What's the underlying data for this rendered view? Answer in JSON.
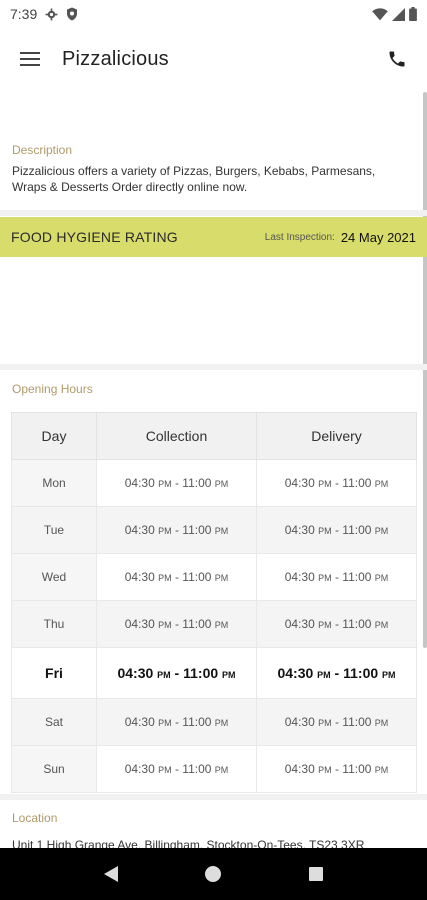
{
  "status_bar": {
    "time": "7:39"
  },
  "app_bar": {
    "title": "Pizzalicious"
  },
  "description": {
    "label": "Description",
    "text": "Pizzalicious offers a variety of Pizzas, Burgers, Kebabs, Parmesans, Wraps & Desserts Order directly online now."
  },
  "hygiene": {
    "label": "FOOD HYGIENE RATING",
    "inspection_label": "Last Inspection:",
    "inspection_date": "24 May 2021",
    "accent_color": "#d8dc6a"
  },
  "opening_hours": {
    "label": "Opening Hours",
    "headers": [
      "Day",
      "Collection",
      "Delivery"
    ],
    "rows": [
      {
        "day": "Mon",
        "col_open": "04:30",
        "col_close": "11:00",
        "del_open": "04:30",
        "del_close": "11:00"
      },
      {
        "day": "Tue",
        "col_open": "04:30",
        "col_close": "11:00",
        "del_open": "04:30",
        "del_close": "11:00"
      },
      {
        "day": "Wed",
        "col_open": "04:30",
        "col_close": "11:00",
        "del_open": "04:30",
        "del_close": "11:00"
      },
      {
        "day": "Thu",
        "col_open": "04:30",
        "col_close": "11:00",
        "del_open": "04:30",
        "del_close": "11:00"
      },
      {
        "day": "Fri",
        "col_open": "04:30",
        "col_close": "11:00",
        "del_open": "04:30",
        "del_close": "11:00"
      },
      {
        "day": "Sat",
        "col_open": "04:30",
        "col_close": "11:00",
        "del_open": "04:30",
        "del_close": "11:00"
      },
      {
        "day": "Sun",
        "col_open": "04:30",
        "col_close": "11:00",
        "del_open": "04:30",
        "del_close": "11:00"
      }
    ],
    "pm_label": "PM",
    "separator": " - ",
    "highlight_day": "Fri"
  },
  "location": {
    "label": "Location",
    "address": "Unit 1 High Grange Ave, Billingham, Stockton-On-Tees, TS23 3XR"
  },
  "icons": {
    "menu": "menu-icon",
    "phone": "phone-icon",
    "settings": "gear-icon",
    "shield": "shield-icon",
    "wifi": "wifi-icon",
    "signal": "signal-icon",
    "battery": "battery-icon",
    "back": "back-icon",
    "home": "home-icon",
    "recents": "recents-icon"
  }
}
